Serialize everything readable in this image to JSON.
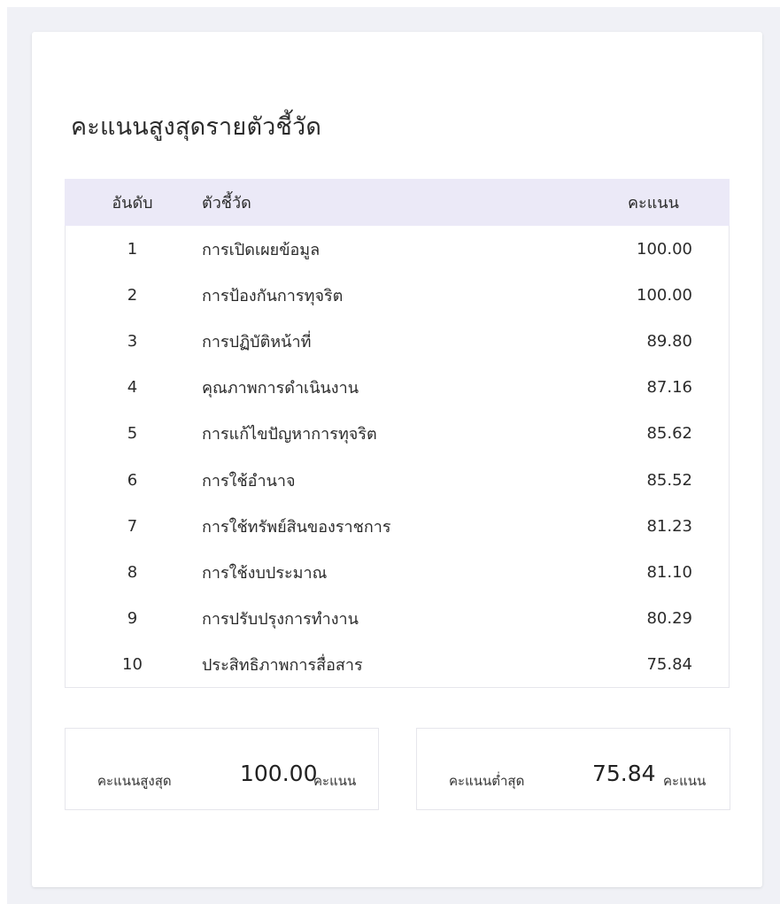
{
  "card": {
    "title": "คะแนนสูงสุดรายตัวชี้วัด"
  },
  "table": {
    "headers": {
      "rank": "อันดับ",
      "indicator": "ตัวชี้วัด",
      "score": "คะแนน"
    },
    "rows": [
      {
        "rank": "1",
        "indicator": "การเปิดเผยข้อมูล",
        "score": "100.00"
      },
      {
        "rank": "2",
        "indicator": "การป้องกันการทุจริต",
        "score": "100.00"
      },
      {
        "rank": "3",
        "indicator": "การปฏิบัติหน้าที่",
        "score": "89.80"
      },
      {
        "rank": "4",
        "indicator": "คุณภาพการดำเนินงาน",
        "score": "87.16"
      },
      {
        "rank": "5",
        "indicator": "การแก้ไขปัญหาการทุจริต",
        "score": "85.62"
      },
      {
        "rank": "6",
        "indicator": "การใช้อำนาจ",
        "score": "85.52"
      },
      {
        "rank": "7",
        "indicator": "การใช้ทรัพย์สินของราชการ",
        "score": "81.23"
      },
      {
        "rank": "8",
        "indicator": "การใช้งบประมาณ",
        "score": "81.10"
      },
      {
        "rank": "9",
        "indicator": "การปรับปรุงการทำงาน",
        "score": "80.29"
      },
      {
        "rank": "10",
        "indicator": "ประสิทธิภาพการสื่อสาร",
        "score": "75.84"
      }
    ]
  },
  "summary": {
    "max": {
      "label": "คะแนนสูงสุด",
      "value": "100.00",
      "unit": "คะแนน"
    },
    "min": {
      "label": "คะแนนต่ำสุด",
      "value": "75.84",
      "unit": "คะแนน"
    }
  },
  "colors": {
    "page_background": "#f0f1f6",
    "card_background": "#ffffff",
    "table_header_background": "#ebe9f7",
    "border": "#e6e6ec"
  }
}
